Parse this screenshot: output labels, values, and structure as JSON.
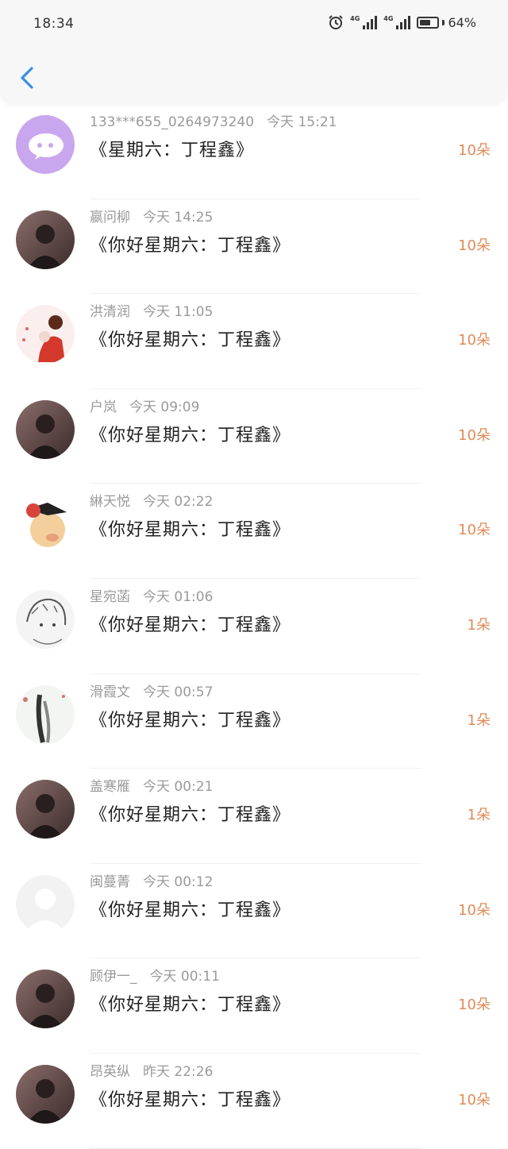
{
  "status_bar": {
    "time": "18:34",
    "network1": "4G",
    "network2": "4G",
    "battery": "64%",
    "battery_level": 0.64
  },
  "header": {
    "back_icon": "chevron-left-icon"
  },
  "colors": {
    "count": "#e08b58",
    "back": "#3a8ee6",
    "wechat_avatar": "#c9a7ee"
  },
  "items": [
    {
      "name": "133***655_0264973240",
      "time": "今天 15:21",
      "message": "《星期六：丁程鑫》",
      "count": "10朵",
      "avatar": "wechat-avatar"
    },
    {
      "name": "嬴问柳",
      "time": "今天 14:25",
      "message": "《你好星期六：丁程鑫》",
      "count": "10朵",
      "avatar": "photo-avatar"
    },
    {
      "name": "洪清润",
      "time": "今天 11:05",
      "message": "《你好星期六：丁程鑫》",
      "count": "10朵",
      "avatar": "illustration-avatar"
    },
    {
      "name": "户岚",
      "time": "今天 09:09",
      "message": "《你好星期六：丁程鑫》",
      "count": "10朵",
      "avatar": "photo-avatar"
    },
    {
      "name": "綝天悦",
      "time": "今天 02:22",
      "message": "《你好星期六：丁程鑫》",
      "count": "10朵",
      "avatar": "cartoon-avatar"
    },
    {
      "name": "星宛菡",
      "time": "今天 01:06",
      "message": "《你好星期六：丁程鑫》",
      "count": "1朵",
      "avatar": "sketch-avatar"
    },
    {
      "name": "滑霞文",
      "time": "今天 00:57",
      "message": "《你好星期六：丁程鑫》",
      "count": "1朵",
      "avatar": "ink-avatar"
    },
    {
      "name": "盖寒雁",
      "time": "今天 00:21",
      "message": "《你好星期六：丁程鑫》",
      "count": "1朵",
      "avatar": "photo-avatar"
    },
    {
      "name": "闽蔓菁",
      "time": "今天 00:12",
      "message": "《你好星期六：丁程鑫》",
      "count": "10朵",
      "avatar": "default-avatar"
    },
    {
      "name": "顾伊一_",
      "time": "今天 00:11",
      "message": "《你好星期六：丁程鑫》",
      "count": "10朵",
      "avatar": "photo-avatar"
    },
    {
      "name": "昂英纵",
      "time": "昨天 22:26",
      "message": "《你好星期六：丁程鑫》",
      "count": "10朵",
      "avatar": "photo-avatar"
    }
  ]
}
